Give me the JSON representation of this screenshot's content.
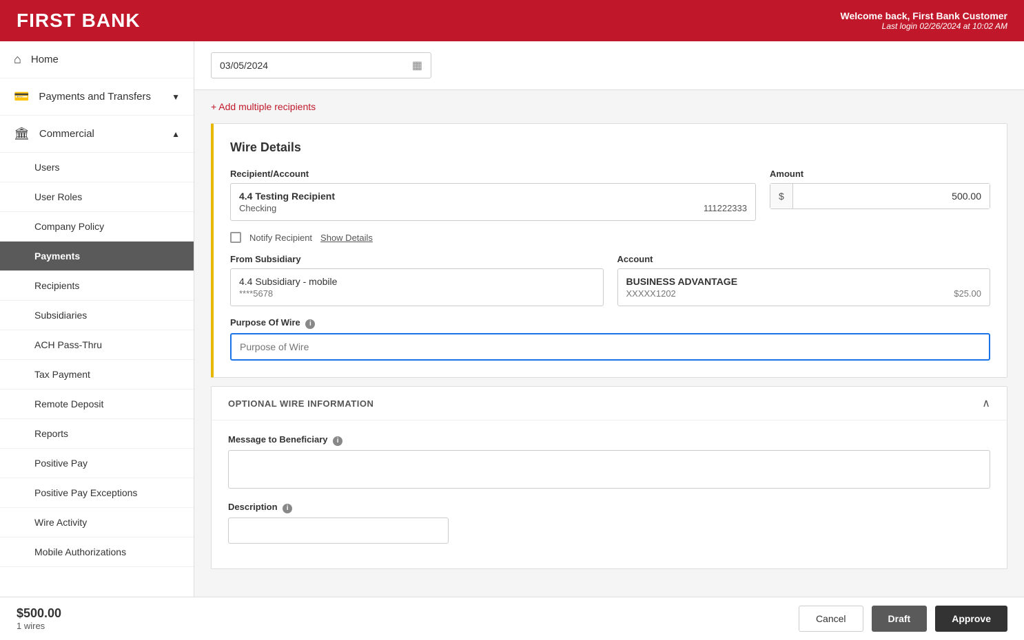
{
  "header": {
    "logo": "FIRST BANK",
    "welcome": "Welcome back, First Bank Customer",
    "last_login": "Last login 02/26/2024 at 10:02 AM"
  },
  "sidebar": {
    "items": [
      {
        "id": "home",
        "label": "Home",
        "icon": "⌂",
        "type": "top"
      },
      {
        "id": "payments-transfers",
        "label": "Payments and Transfers",
        "icon": "💳",
        "type": "top",
        "chevron": "▼"
      },
      {
        "id": "commercial",
        "label": "Commercial",
        "icon": "🏛",
        "type": "top",
        "chevron": "▲"
      }
    ],
    "sub_items": [
      {
        "id": "users",
        "label": "Users"
      },
      {
        "id": "user-roles",
        "label": "User Roles"
      },
      {
        "id": "company-policy",
        "label": "Company Policy"
      },
      {
        "id": "payments",
        "label": "Payments",
        "active": true
      },
      {
        "id": "recipients",
        "label": "Recipients"
      },
      {
        "id": "subsidiaries",
        "label": "Subsidiaries"
      },
      {
        "id": "ach-pass-thru",
        "label": "ACH Pass-Thru"
      },
      {
        "id": "tax-payment",
        "label": "Tax Payment"
      },
      {
        "id": "remote-deposit",
        "label": "Remote Deposit"
      },
      {
        "id": "reports",
        "label": "Reports"
      },
      {
        "id": "positive-pay",
        "label": "Positive Pay"
      },
      {
        "id": "positive-pay-exceptions",
        "label": "Positive Pay Exceptions"
      },
      {
        "id": "wire-activity",
        "label": "Wire Activity"
      },
      {
        "id": "mobile-authorizations",
        "label": "Mobile Authorizations"
      }
    ]
  },
  "main": {
    "date_value": "03/05/2024",
    "add_recipients_label": "+ Add multiple recipients",
    "wire_details": {
      "title": "Wire Details",
      "recipient_label": "Recipient/Account",
      "recipient_name": "4.4 Testing Recipient",
      "recipient_type": "Checking",
      "recipient_account": "111222333",
      "amount_label": "Amount",
      "amount_symbol": "$",
      "amount_value": "500.00",
      "notify_label": "Notify Recipient",
      "show_details_label": "Show Details",
      "from_subsidiary_label": "From Subsidiary",
      "subsidiary_name": "4.4 Subsidiary - mobile",
      "subsidiary_account": "****5678",
      "account_label": "Account",
      "account_name": "BUSINESS ADVANTAGE",
      "account_number": "XXXXX1202",
      "account_balance": "$25.00",
      "purpose_label": "Purpose Of Wire",
      "purpose_placeholder": "Purpose of Wire"
    },
    "optional_section": {
      "header": "OPTIONAL WIRE INFORMATION",
      "message_label": "Message to Beneficiary",
      "message_info": "ⓘ",
      "description_label": "Description",
      "description_info": "ⓘ"
    },
    "footer": {
      "total_amount": "$500.00",
      "wire_count": "1 wires",
      "cancel_label": "Cancel",
      "draft_label": "Draft",
      "approve_label": "Approve"
    }
  }
}
